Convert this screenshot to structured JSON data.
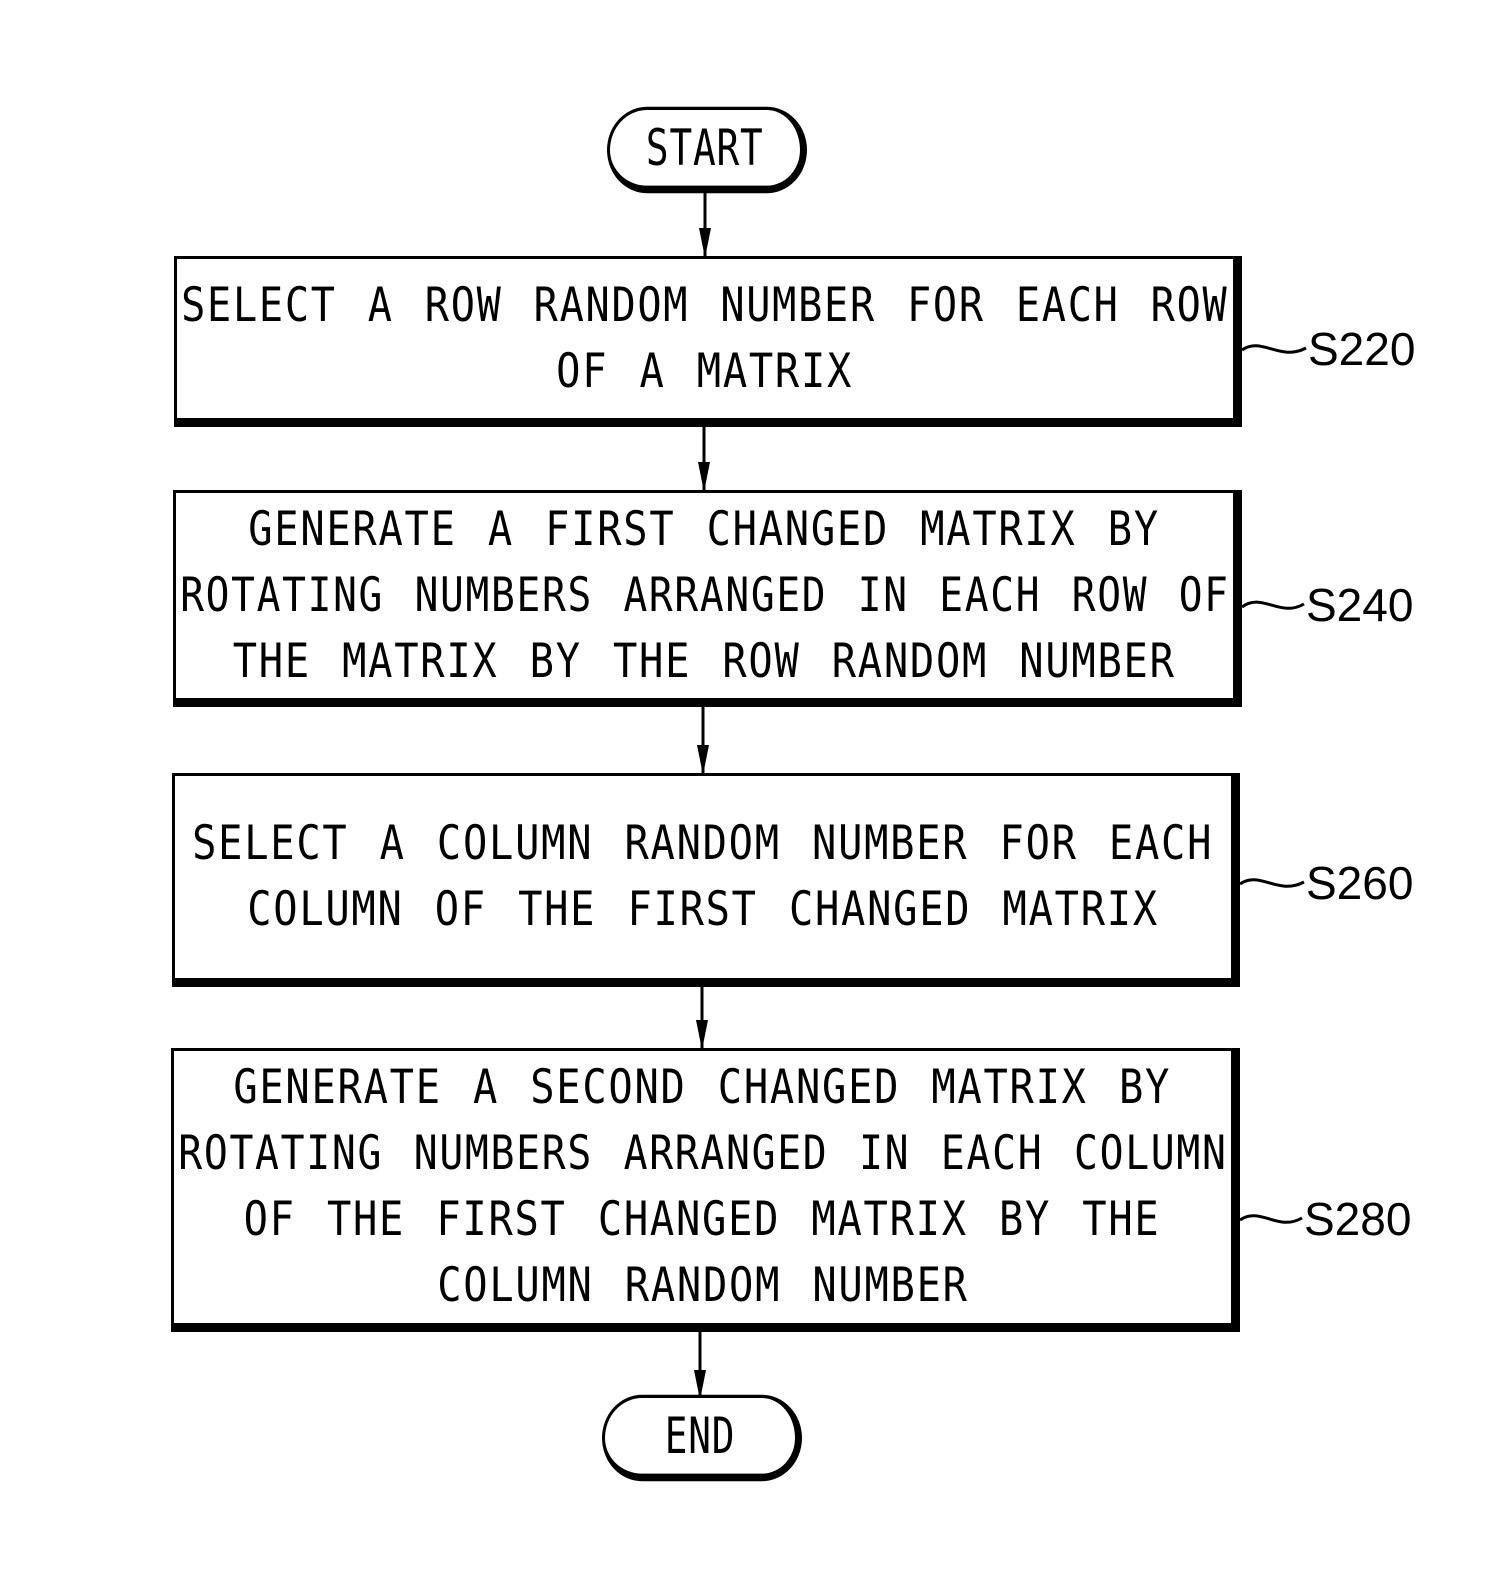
{
  "diagram": {
    "type": "flowchart",
    "start": {
      "label": "START"
    },
    "end": {
      "label": "END"
    },
    "steps": [
      {
        "id": "S220",
        "label_tag": "S220",
        "lines": [
          "SELECT A ROW RANDOM NUMBER FOR EACH ROW",
          "OF A MATRIX"
        ]
      },
      {
        "id": "S240",
        "label_tag": "S240",
        "lines": [
          "GENERATE A FIRST CHANGED MATRIX BY",
          "ROTATING NUMBERS ARRANGED IN EACH ROW OF",
          "THE MATRIX BY THE ROW RANDOM NUMBER"
        ]
      },
      {
        "id": "S260",
        "label_tag": "S260",
        "lines": [
          "SELECT A COLUMN RANDOM NUMBER FOR EACH",
          "COLUMN OF THE FIRST CHANGED MATRIX"
        ]
      },
      {
        "id": "S280",
        "label_tag": "S280",
        "lines": [
          "GENERATE A SECOND CHANGED MATRIX BY",
          "ROTATING NUMBERS ARRANGED IN EACH COLUMN",
          "OF THE FIRST CHANGED MATRIX BY THE",
          "COLUMN RANDOM NUMBER"
        ]
      }
    ],
    "edges": [
      {
        "from": "START",
        "to": "S220"
      },
      {
        "from": "S220",
        "to": "S240"
      },
      {
        "from": "S240",
        "to": "S260"
      },
      {
        "from": "S260",
        "to": "S280"
      },
      {
        "from": "S280",
        "to": "END"
      }
    ],
    "colors": {
      "ink": "#000000",
      "background": "#ffffff"
    }
  }
}
